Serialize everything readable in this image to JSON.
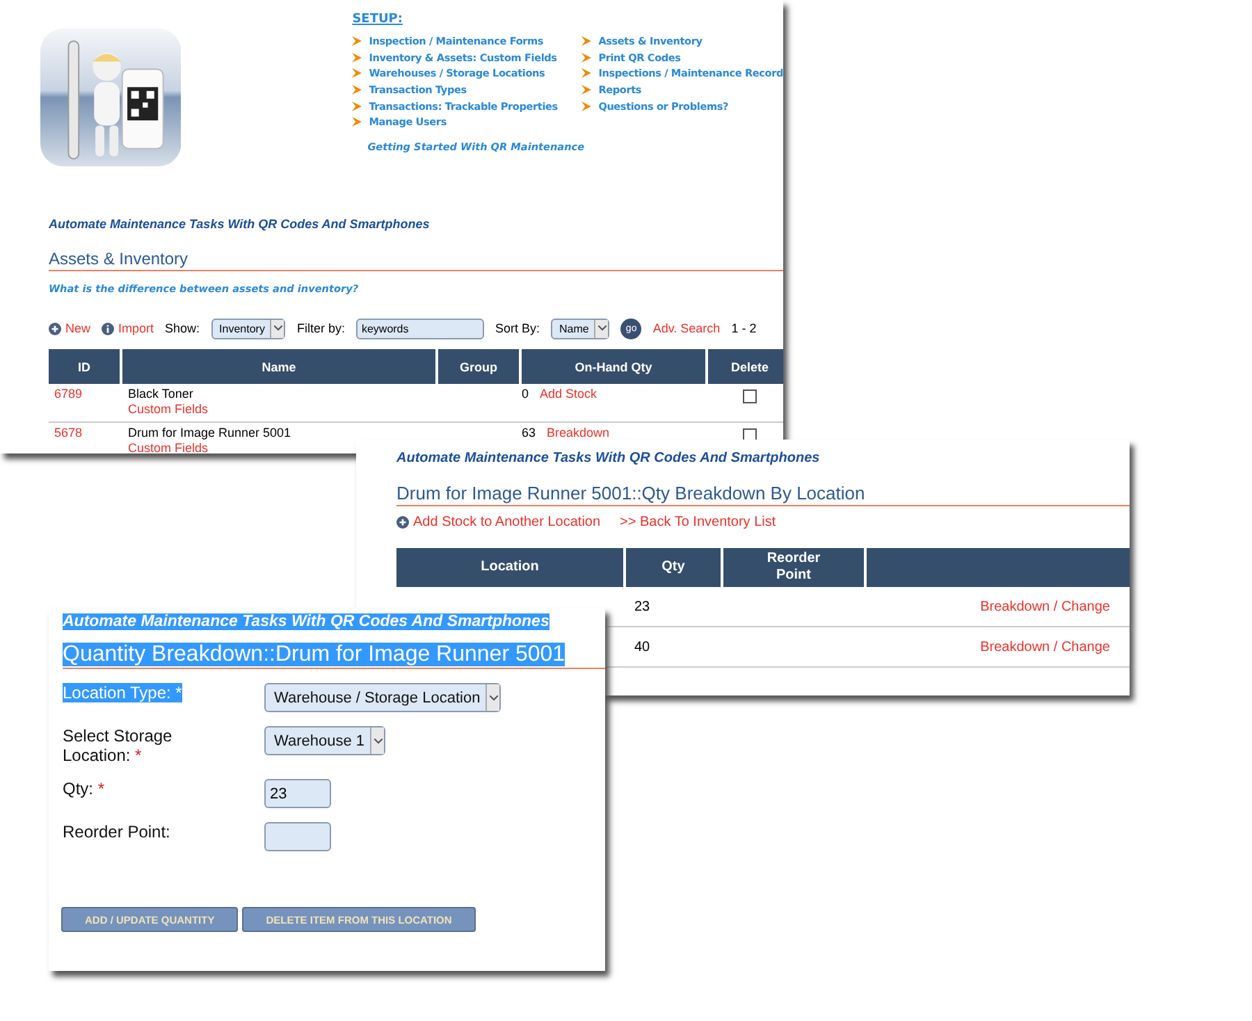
{
  "inventory_window": {
    "setup": {
      "title": "SETUP:",
      "links_left": [
        "Inspection / Maintenance Forms",
        "Inventory & Assets: Custom Fields",
        "Warehouses / Storage Locations",
        "Transaction Types",
        "Transactions: Trackable Properties",
        "Manage Users"
      ],
      "links_right": [
        "Assets & Inventory",
        "Print QR Codes",
        "Inspections / Maintenance Record",
        "Reports",
        "Questions or Problems?"
      ],
      "getting_started": "Getting Started With QR Maintenance"
    },
    "tagline": "Automate Maintenance Tasks With QR Codes And Smartphones",
    "heading": "Assets & Inventory",
    "question_link": "What is the difference between assets and inventory?",
    "toolbar": {
      "new": "New",
      "import": "Import",
      "show_label": "Show:",
      "show_value": "Inventory",
      "filter_label": "Filter by:",
      "filter_value": "keywords",
      "sort_label": "Sort By:",
      "sort_value": "Name",
      "go": "go",
      "adv_search": "Adv. Search",
      "range": "1 - 2"
    },
    "table": {
      "columns": [
        "ID",
        "Name",
        "Group",
        "On-Hand Qty",
        "Delete"
      ],
      "rows": [
        {
          "id": "6789",
          "name": "Black Toner",
          "link": "Custom Fields",
          "qty": "0",
          "action": "Add Stock",
          "delete_checked": false
        },
        {
          "id": "5678",
          "name": "Drum for Image Runner 5001",
          "link": "Custom Fields",
          "qty": "63",
          "action": "Breakdown",
          "delete_checked": false
        }
      ]
    }
  },
  "breakdown_window": {
    "tagline": "Automate Maintenance Tasks With QR Codes And Smartphones",
    "heading": "Drum for Image Runner 5001::Qty Breakdown By Location",
    "add_link": "Add Stock to Another Location",
    "back_link": ">> Back To Inventory List",
    "table": {
      "columns": [
        "Location",
        "Qty",
        "Reorder Point"
      ],
      "rows": [
        {
          "qty": "23",
          "action": "Breakdown / Change"
        },
        {
          "qty": "40",
          "action": "Breakdown / Change"
        }
      ]
    }
  },
  "edit_window": {
    "tagline": {
      "text": "Automate Maintenance Tasks With QR Codes And Smartphones",
      "highlighted": true
    },
    "heading": {
      "text": "Quantity Breakdown::Drum for Image Runner 5001",
      "highlighted": true
    },
    "fields": [
      {
        "kind": "select",
        "label": "Location Type:",
        "mark": "*",
        "value": "Warehouse / Storage Location",
        "highlighted": true
      },
      {
        "kind": "select",
        "label": "Select Storage Location:",
        "mark": "*",
        "value": "Warehouse 1",
        "highlighted": false
      },
      {
        "kind": "input",
        "label": "Qty:",
        "mark": "*",
        "value": "23",
        "highlighted": false
      },
      {
        "kind": "input",
        "label": "Reorder Point:",
        "highlighted": false
      }
    ],
    "buttons": [
      "ADD / UPDATE QUANTITY",
      "DELETE ITEM FROM THIS LOCATION"
    ]
  }
}
